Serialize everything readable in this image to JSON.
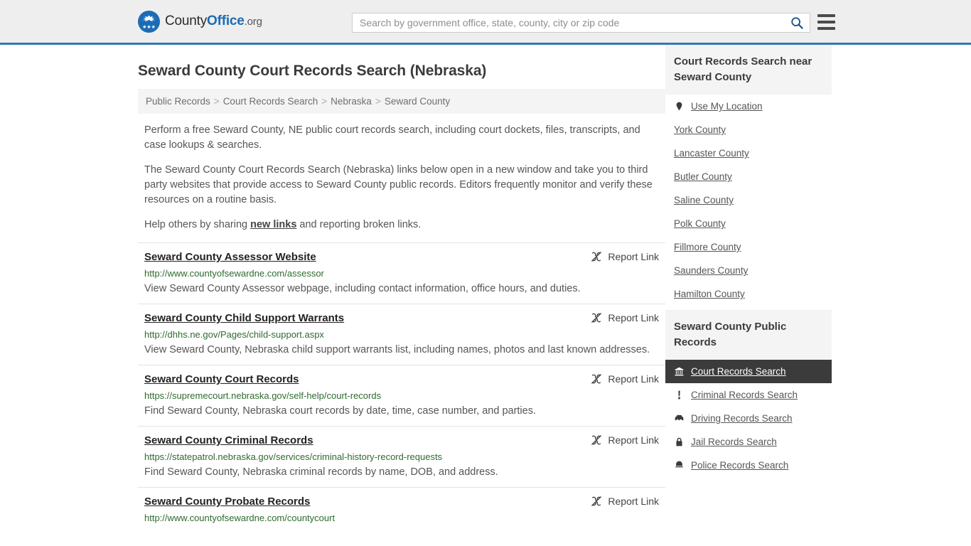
{
  "header": {
    "logo": {
      "prefix": "County",
      "bold": "Office",
      "suffix": ".org",
      "icon": "eagle-emblem-icon",
      "stars": "★★★"
    },
    "search": {
      "value": "",
      "placeholder": "Search by government office, state, county, city or zip code",
      "button_icon": "search-icon"
    },
    "menu_icon": "hamburger-menu-icon"
  },
  "page": {
    "title": "Seward County Court Records Search (Nebraska)"
  },
  "breadcrumb": {
    "separator": ">",
    "items": [
      "Public Records",
      "Court Records Search",
      "Nebraska",
      "Seward County"
    ]
  },
  "intro": {
    "paragraph1": "Perform a free Seward County, NE public court records search, including court dockets, files, transcripts, and case lookups & searches.",
    "paragraph2": "The Seward County Court Records Search (Nebraska) links below open in a new window and take you to third party websites that provide access to Seward County public records. Editors frequently monitor and verify these resources on a routine basis.",
    "help_prefix": "Help others by sharing ",
    "help_link": "new links",
    "help_suffix": " and reporting broken links."
  },
  "report_link": {
    "label": "Report Link",
    "icon": "broken-link-icon"
  },
  "results": [
    {
      "title": "Seward County Assessor Website",
      "url": "http://www.countyofsewardne.com/assessor",
      "description": "View Seward County Assessor webpage, including contact information, office hours, and duties."
    },
    {
      "title": "Seward County Child Support Warrants",
      "url": "http://dhhs.ne.gov/Pages/child-support.aspx",
      "description": "View Seward County, Nebraska child support warrants list, including names, photos and last known addresses."
    },
    {
      "title": "Seward County Court Records",
      "url": "https://supremecourt.nebraska.gov/self-help/court-records",
      "description": "Find Seward County, Nebraska court records by date, time, case number, and parties."
    },
    {
      "title": "Seward County Criminal Records",
      "url": "https://statepatrol.nebraska.gov/services/criminal-history-record-requests",
      "description": "Find Seward County, Nebraska criminal records by name, DOB, and address."
    },
    {
      "title": "Seward County Probate Records",
      "url": "http://www.countyofsewardne.com/countycourt",
      "description": ""
    }
  ],
  "sidebar": {
    "nearby": {
      "heading": "Court Records Search near Seward County",
      "items": [
        {
          "label": "Use My Location",
          "icon": "map-pin-icon",
          "active": false
        },
        {
          "label": "York County",
          "icon": "",
          "active": false
        },
        {
          "label": "Lancaster County",
          "icon": "",
          "active": false
        },
        {
          "label": "Butler County",
          "icon": "",
          "active": false
        },
        {
          "label": "Saline County",
          "icon": "",
          "active": false
        },
        {
          "label": "Polk County",
          "icon": "",
          "active": false
        },
        {
          "label": "Fillmore County",
          "icon": "",
          "active": false
        },
        {
          "label": "Saunders County",
          "icon": "",
          "active": false
        },
        {
          "label": "Hamilton County",
          "icon": "",
          "active": false
        }
      ]
    },
    "public_records": {
      "heading": "Seward County Public Records",
      "items": [
        {
          "label": "Court Records Search",
          "icon": "courthouse-icon",
          "active": true
        },
        {
          "label": "Criminal Records Search",
          "icon": "exclamation-icon",
          "active": false
        },
        {
          "label": "Driving Records Search",
          "icon": "car-icon",
          "active": false
        },
        {
          "label": "Jail Records Search",
          "icon": "lock-icon",
          "active": false
        },
        {
          "label": "Police Records Search",
          "icon": "police-badge-icon",
          "active": false
        }
      ]
    }
  }
}
